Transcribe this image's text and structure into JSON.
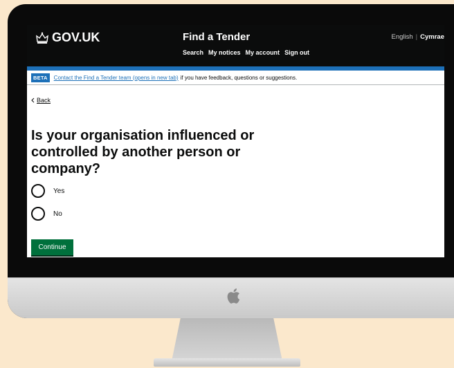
{
  "header": {
    "logo_text": "GOV.UK",
    "service_name": "Find a Tender",
    "nav": [
      "Search",
      "My notices",
      "My account",
      "Sign out"
    ],
    "language": {
      "english": "English",
      "cymraeg": "Cymrae"
    }
  },
  "phase_banner": {
    "tag": "BETA",
    "link_text": "Contact the Find a Tender team (opens in new tab)",
    "suffix": "if you have feedback, questions or suggestions."
  },
  "back_link": {
    "label": "Back"
  },
  "question": {
    "heading": "Is your organisation influenced or controlled by another person or company?",
    "options": [
      {
        "label": "Yes",
        "selected": false
      },
      {
        "label": "No",
        "selected": false
      }
    ]
  },
  "continue_label": "Continue",
  "icons": {
    "logo": "crown-icon",
    "back": "chevron-left-icon",
    "chin": "apple-logo-icon"
  },
  "colors": {
    "background": "#fbe8cc",
    "header": "#0b0c0c",
    "accent_bar": "#1d70b8",
    "button": "#00703c"
  }
}
